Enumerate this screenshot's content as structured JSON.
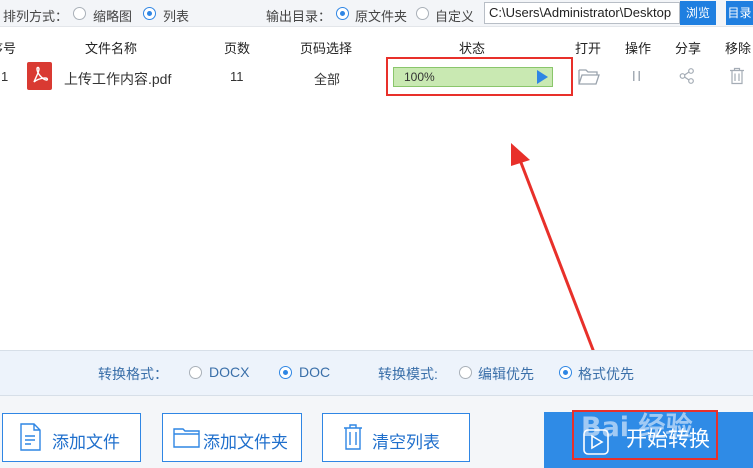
{
  "toolbar": {
    "sort_label": "排列方式：",
    "view_thumbnail": "缩略图",
    "view_list": "列表",
    "output_dir_label": "输出目录：",
    "output_original": "原文件夹",
    "output_custom": "自定义",
    "path_value": "C:\\Users\\Administrator\\Desktop",
    "browse_label": "浏览",
    "cut_button_label": "目录"
  },
  "table": {
    "headers": {
      "index": "序号",
      "name": "文件名称",
      "pages": "页数",
      "page_select": "页码选择",
      "status": "状态",
      "open": "打开",
      "action": "操作",
      "share": "分享",
      "remove": "移除"
    },
    "rows": [
      {
        "index": "1",
        "name": "上传工作内容.pdf",
        "pages": "11",
        "page_select": "全部",
        "progress_text": "100%",
        "progress": 1.0
      }
    ]
  },
  "format": {
    "label": "转换格式：",
    "docx": "DOCX",
    "doc": "DOC",
    "mode_label": "转换模式:",
    "mode_edit": "编辑优先",
    "mode_format": "格式优先"
  },
  "actions": {
    "add_file": "添加文件",
    "add_folder": "添加文件夹",
    "clear_list": "清空列表",
    "start": "开始转换"
  },
  "watermark": "Bai 经验",
  "colors": {
    "accent": "#2f86e4",
    "highlight": "#e8302a",
    "progress": "#c9e9b2"
  }
}
